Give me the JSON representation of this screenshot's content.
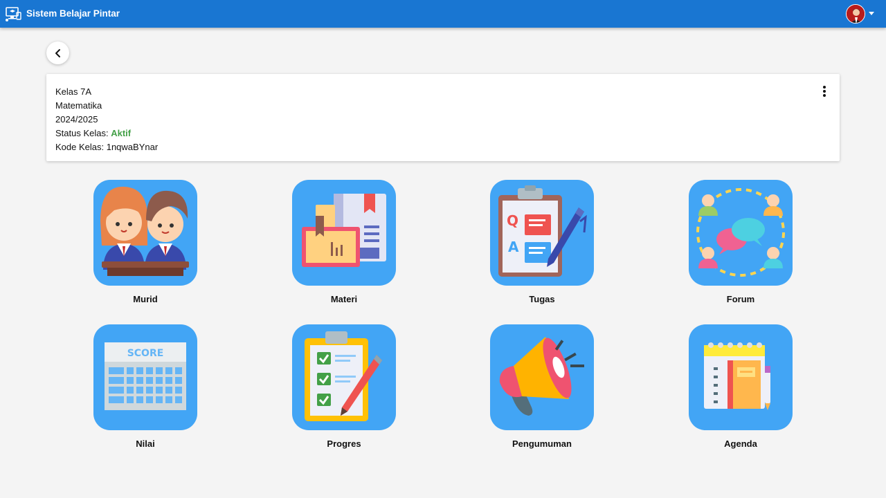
{
  "appbar": {
    "title": "Sistem Belajar Pintar",
    "logo_icon": "computer-school-icon",
    "avatar_icon": "user-avatar-icon",
    "menu_icon": "caret-down-icon",
    "color": "#1976d2"
  },
  "back_button": {
    "icon": "chevron-left-icon"
  },
  "class_info": {
    "class_name": "Kelas 7A",
    "subject": "Matematika",
    "year": "2024/2025",
    "status_label": "Status Kelas: ",
    "status_value": "Aktif",
    "status_color": "#43a047",
    "code_label": "Kode Kelas: ",
    "code_value": "1nqwaBYnar",
    "more_icon": "more-vertical-icon"
  },
  "menu": [
    {
      "label": "Murid",
      "icon": "students-icon"
    },
    {
      "label": "Materi",
      "icon": "books-icon"
    },
    {
      "label": "Tugas",
      "icon": "clipboard-qa-icon"
    },
    {
      "label": "Forum",
      "icon": "discussion-icon"
    },
    {
      "label": "Nilai",
      "icon": "score-board-icon"
    },
    {
      "label": "Progres",
      "icon": "checklist-icon"
    },
    {
      "label": "Pengumuman",
      "icon": "megaphone-icon"
    },
    {
      "label": "Agenda",
      "icon": "notebook-icon"
    }
  ],
  "colors": {
    "tile": "#42a5f5",
    "background": "#f4f4f4"
  }
}
